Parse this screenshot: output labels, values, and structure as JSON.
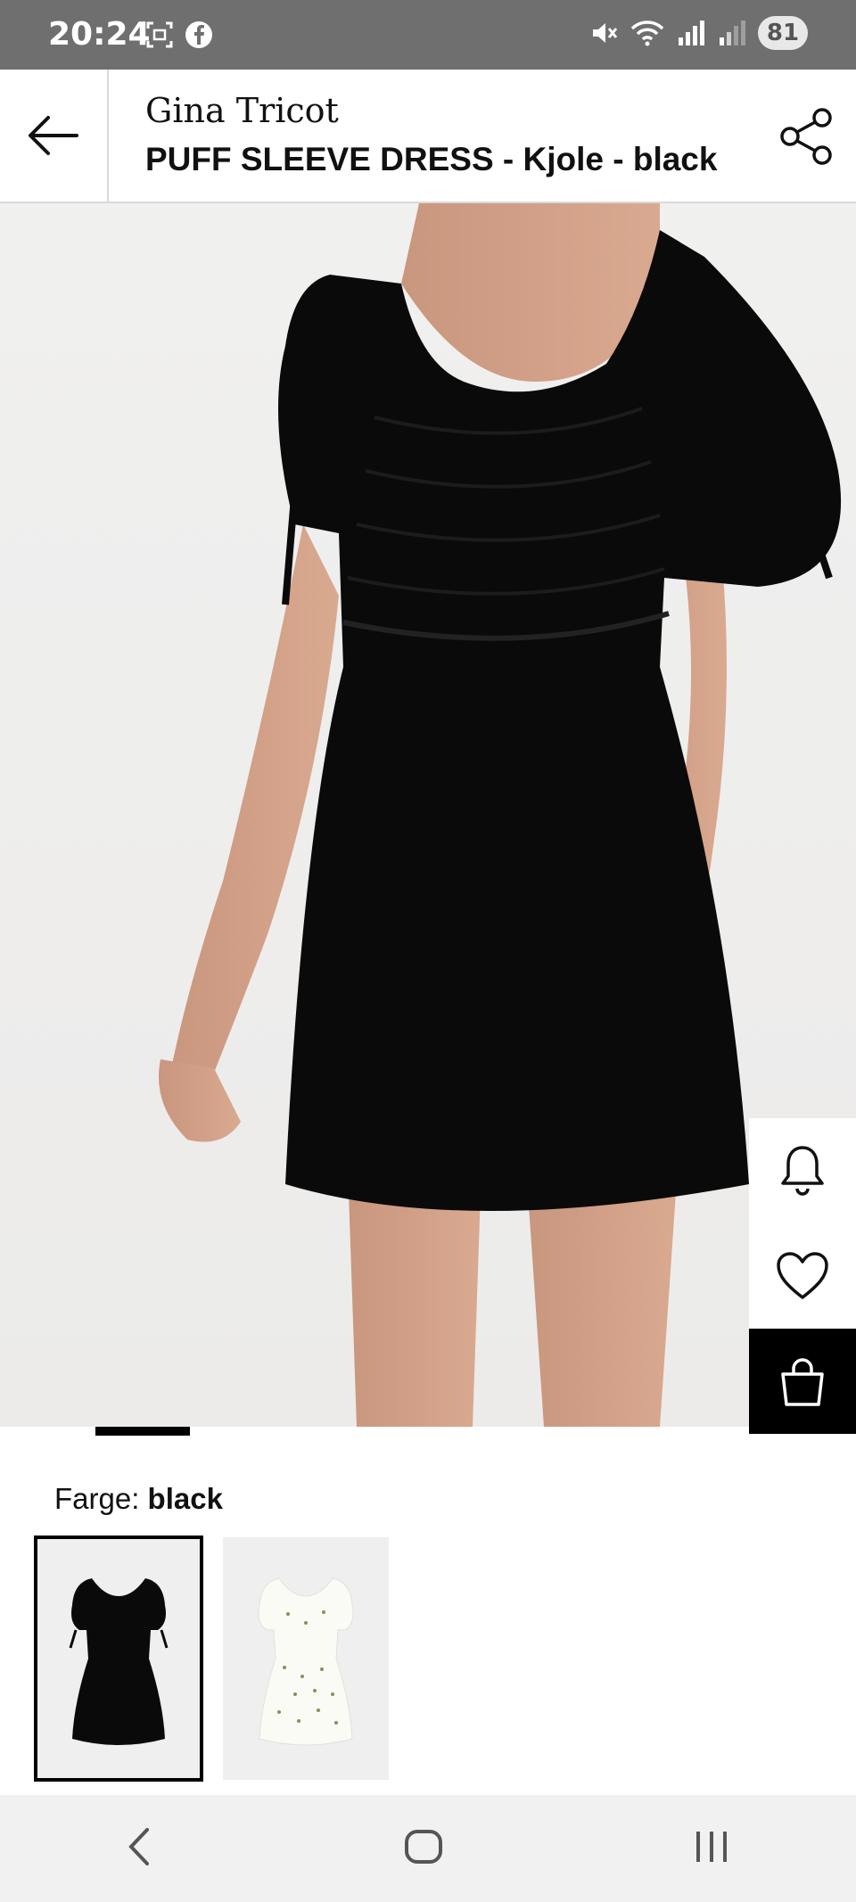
{
  "status_bar": {
    "time": "20:24",
    "battery": "81",
    "icons": [
      "screenshot-icon",
      "facebook-icon",
      "mute-icon",
      "wifi-icon",
      "signal-icon",
      "signal-icon-2"
    ]
  },
  "header": {
    "brand": "Gina Tricot",
    "title": "PUFF SLEEVE DRESS - Kjole - black",
    "back_icon": "back-arrow-icon",
    "share_icon": "share-icon"
  },
  "hero": {
    "side_actions": [
      "bell-icon",
      "heart-icon",
      "bag-icon"
    ],
    "left_action": "visual-search-icon"
  },
  "color_section": {
    "label": "Farge:",
    "value": "black",
    "swatches": [
      {
        "name": "black",
        "selected": true
      },
      {
        "name": "white floral",
        "selected": false
      }
    ]
  },
  "nav_bar": {
    "buttons": [
      "back-nav-icon",
      "home-nav-icon",
      "recents-nav-icon"
    ]
  },
  "colors": {
    "accent": "#000000",
    "status_bar": "#6f6f6f",
    "nav_bar": "#f1f1f1"
  }
}
